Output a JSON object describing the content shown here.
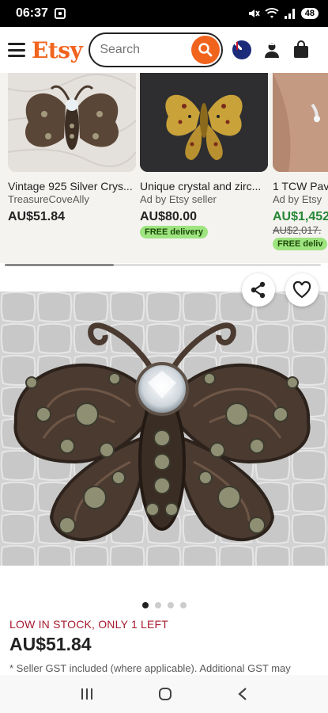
{
  "status_bar": {
    "time": "06:37",
    "battery": "48"
  },
  "header": {
    "logo": "Etsy",
    "search_placeholder": "Search"
  },
  "carousel": [
    {
      "title": "Vintage 925 Silver Crys...",
      "seller": "TreasureCoveAlly",
      "price": "AU$51.84"
    },
    {
      "title": "Unique crystal and zirc...",
      "seller": "Ad by Etsy seller",
      "price": "AU$80.00",
      "badge": "FREE delivery"
    },
    {
      "title": "1 TCW Pav",
      "seller": "Ad by Etsy",
      "price": "AU$1,452",
      "old_price": "AU$2,017.",
      "badge": "FREE deliv"
    }
  ],
  "listing": {
    "stock_notice": "LOW IN STOCK, ONLY 1 LEFT",
    "price": "AU$51.84",
    "gst_note": "* Seller GST included (where applicable). Additional GST may"
  },
  "image_dots": {
    "count": 4,
    "active": 0
  },
  "colors": {
    "brand": "#f1641e",
    "stock_red": "#a61a2e",
    "sale_green": "#258635",
    "badge_green": "#9ee480"
  }
}
